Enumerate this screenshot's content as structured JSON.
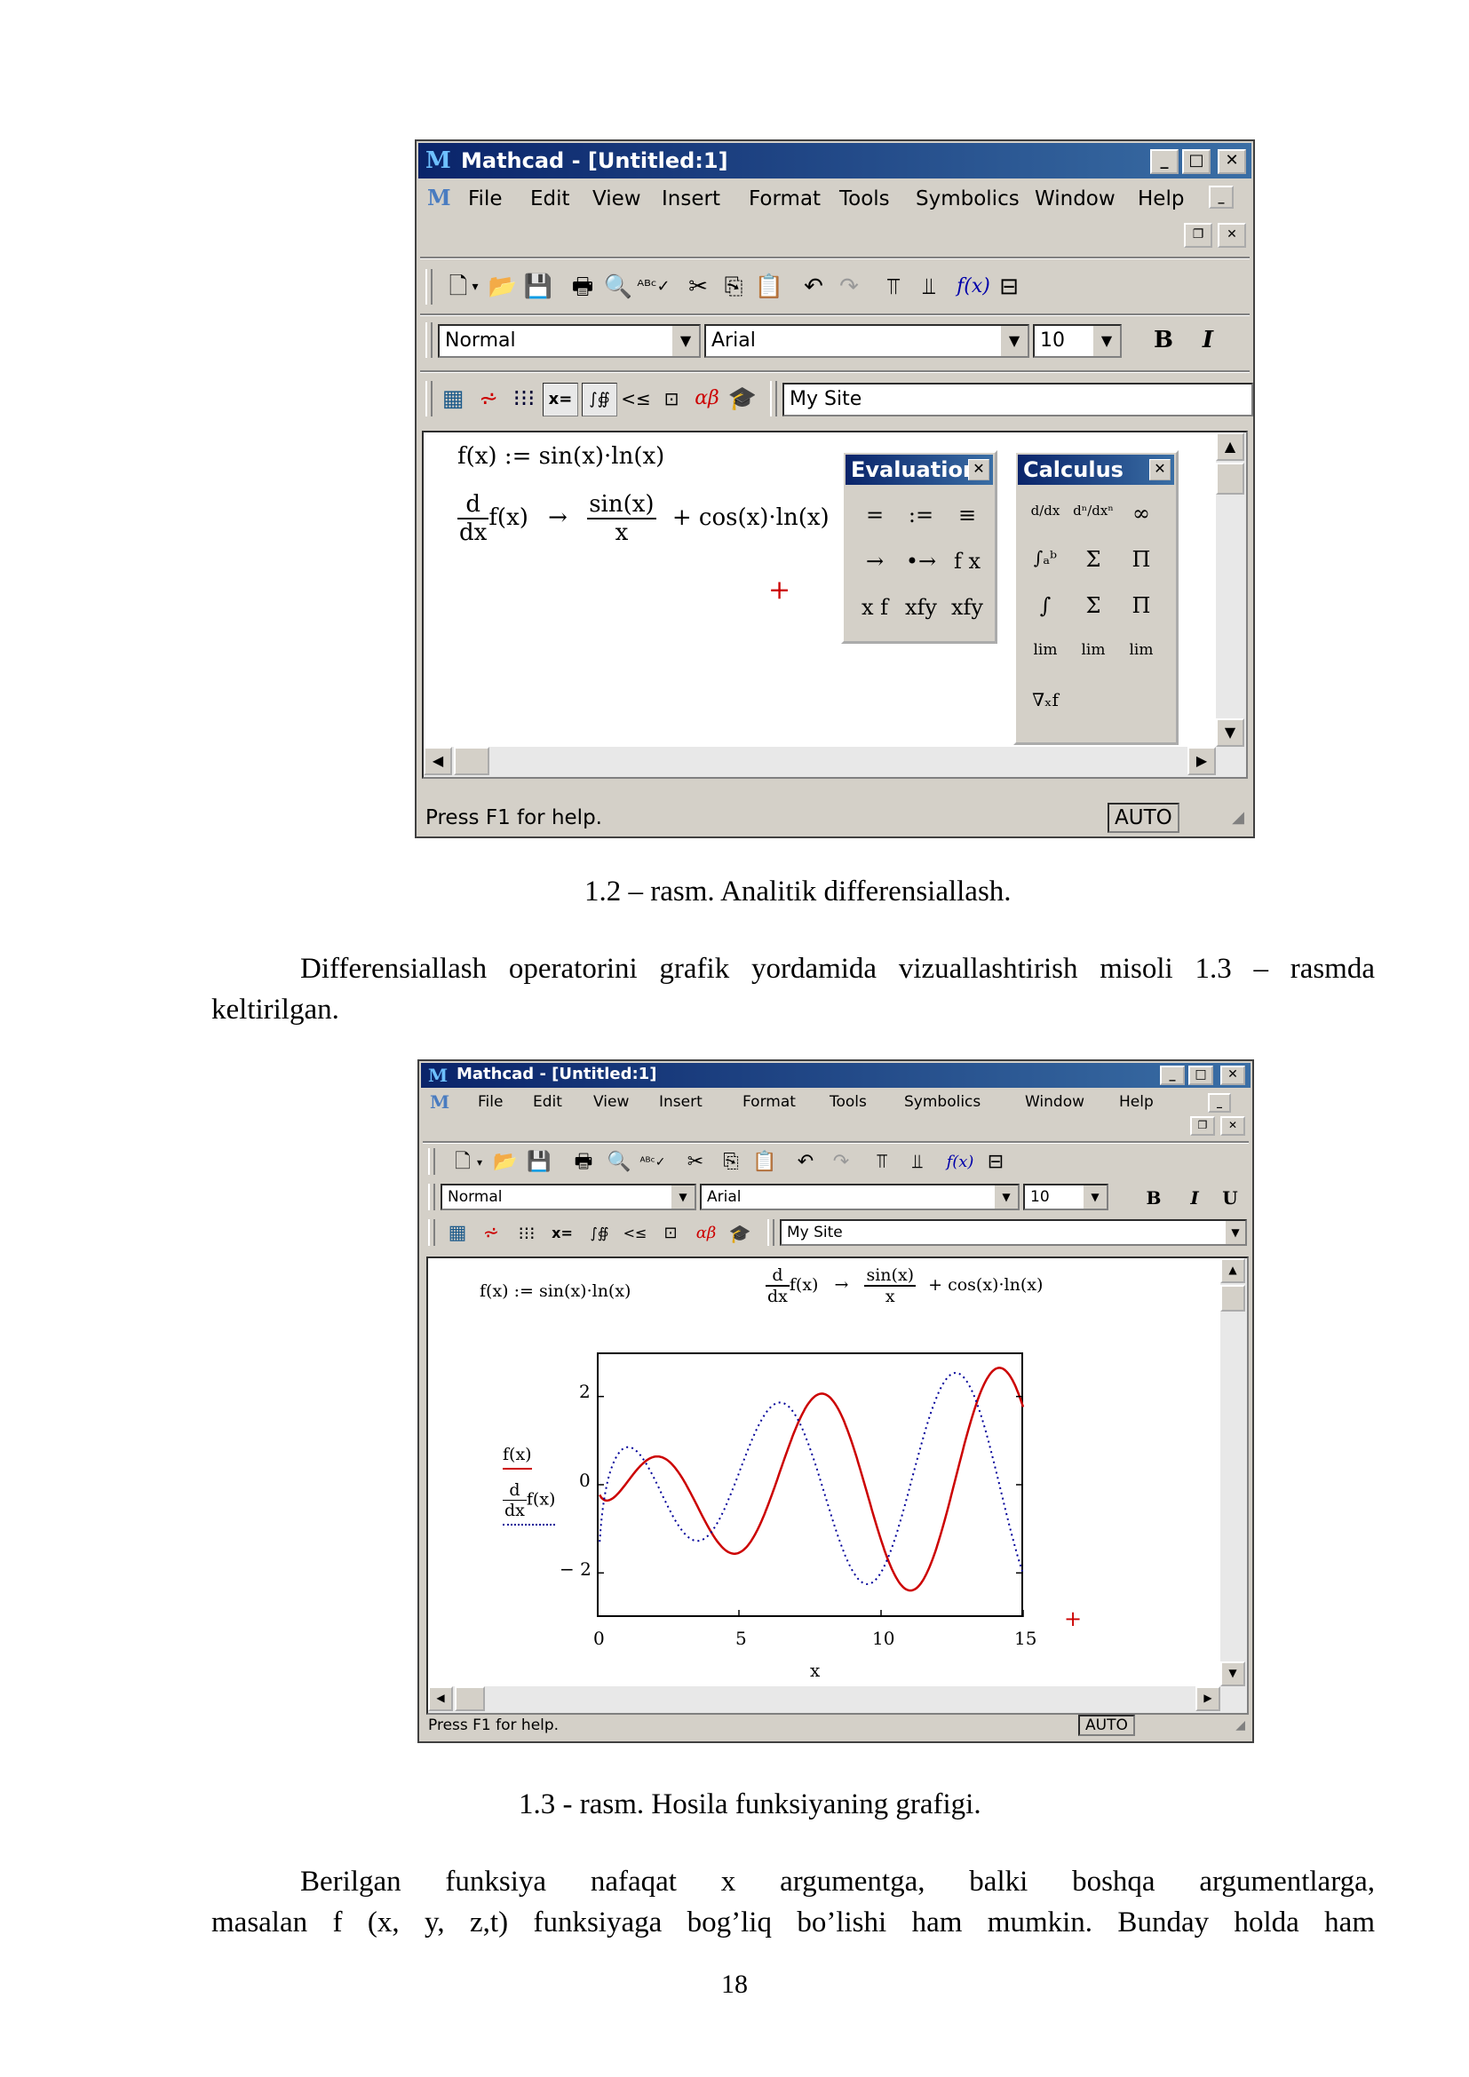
{
  "screenshot1": {
    "title": "Mathcad - [Untitled:1]",
    "menu": [
      "File",
      "Edit",
      "View",
      "Insert",
      "Format",
      "Tools",
      "Symbolics",
      "Window",
      "Help"
    ],
    "style_combo": "Normal",
    "font_combo": "Arial",
    "size_combo": "10",
    "bold": "B",
    "italic": "I",
    "url_combo": "My Site",
    "status_text": "Press F1 for help.",
    "status_mode": "AUTO",
    "math_def": "f(x) := sin(x)·ln(x)",
    "deriv_d": "d",
    "deriv_dx": "dx",
    "deriv_f": "f(x)",
    "arrow": "→",
    "frac_num": "sin(x)",
    "frac_den": "x",
    "deriv_rest": "+ cos(x)·ln(x)",
    "cursor": "+",
    "evaluation_palette": {
      "title": "Evaluation",
      "buttons": [
        "=",
        ":=",
        "≡",
        "→",
        "•→",
        "f x",
        "x f",
        "xfy",
        "xfy"
      ]
    },
    "calculus_palette": {
      "title": "Calculus",
      "buttons": [
        "d/dx",
        "dⁿ/dxⁿ",
        "∞",
        "∫ₐᵇ",
        "Σ",
        "Π",
        "∫",
        "Σ",
        "Π",
        "lim",
        "lim",
        "lim",
        "∇ₓf"
      ]
    }
  },
  "caption1": "1.2 – rasm. Analitik differensiallash.",
  "paragraph1": "Differensiallash operatorini grafik yordamida vizuallashtirish misoli 1.3 – rasmda keltirilgan.",
  "screenshot2": {
    "title": "Mathcad - [Untitled:1]",
    "menu": [
      "File",
      "Edit",
      "View",
      "Insert",
      "Format",
      "Tools",
      "Symbolics",
      "Window",
      "Help"
    ],
    "style_combo": "Normal",
    "font_combo": "Arial",
    "size_combo": "10",
    "bold": "B",
    "italic": "I",
    "underline": "U",
    "url_combo": "My Site",
    "status_text": "Press F1 for help.",
    "status_mode": "AUTO",
    "math_def": "f(x) := sin(x)·ln(x)",
    "deriv_d": "d",
    "deriv_dx": "dx",
    "deriv_f": "f(x)",
    "arrow": "→",
    "frac_num": "sin(x)",
    "frac_den": "x",
    "deriv_rest": "+ cos(x)·ln(x)",
    "legend_f": "f(x)",
    "legend_d": "d",
    "legend_dx": "dx",
    "legend_df": "f(x)",
    "cursor": "+"
  },
  "chart_data": {
    "type": "line",
    "xlabel": "x",
    "xlim": [
      0,
      15
    ],
    "ylim": [
      -3,
      3
    ],
    "xticks": [
      "0",
      "5",
      "10",
      "15"
    ],
    "yticks": [
      "2",
      "0",
      "− 2"
    ],
    "series": [
      {
        "name": "f(x)",
        "expr": "sin(x)·ln(x)",
        "style": "solid",
        "color": "#cc0000"
      },
      {
        "name": "d/dx f(x)",
        "expr": "sin(x)/x + cos(x)·ln(x)",
        "style": "dotted",
        "color": "#000099"
      }
    ],
    "x_start": 0.1,
    "x_end": 15,
    "grid": false
  },
  "caption2": "1.3 - rasm. Hosila funksiyaning grafigi.",
  "paragraph2_line1": "Berilgan funksiya nafaqat x argumentga, balki boshqa argumentlarga,",
  "paragraph2_line2": "masalan f (x, y, z,t) funksiyaga bog’liq bo’lishi ham mumkin. Bunday holda ham",
  "page_number": "18"
}
